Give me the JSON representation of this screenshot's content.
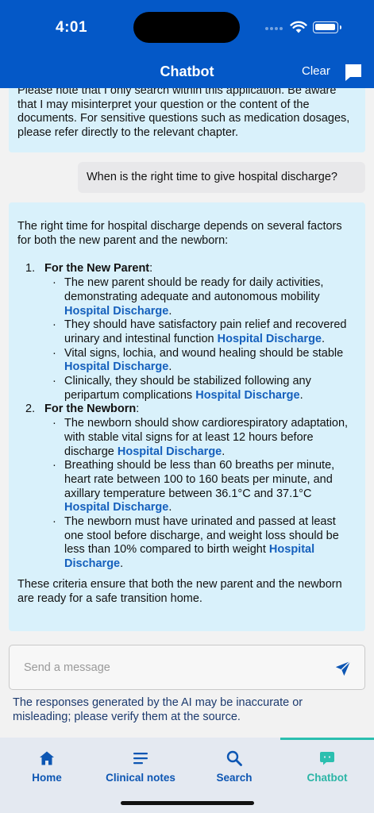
{
  "status": {
    "time": "4:01"
  },
  "header": {
    "title": "Chatbot",
    "clear_label": "Clear"
  },
  "messages": {
    "first_bot": {
      "line_cut": "Please note that I only search within this application. Be aware",
      "text": "that I may misinterpret your question or the content of the documents. For sensitive questions such as medication dosages, please refer directly to the relevant chapter."
    },
    "user": "When is the right time to give hospital discharge?",
    "bot": {
      "intro": "The right time for hospital discharge depends on several factors for both the new parent and the newborn:",
      "sections": [
        {
          "num": "1.",
          "title": "For the New Parent",
          "items": [
            {
              "text": "The new parent should be ready for daily activities, demonstrating adequate and autonomous mobility ",
              "ref": "Hospital Discharge",
              "end": "."
            },
            {
              "text": "They should have satisfactory pain relief and recovered urinary and intestinal function ",
              "ref": "Hospital Discharge",
              "end": "."
            },
            {
              "text": "Vital signs, lochia, and wound healing should be stable ",
              "ref": "Hospital Discharge",
              "end": "."
            },
            {
              "text": "Clinically, they should be stabilized following any peripartum complications ",
              "ref": "Hospital Discharge",
              "end": "."
            }
          ]
        },
        {
          "num": "2.",
          "title": "For the Newborn",
          "items": [
            {
              "text": "The newborn should show cardiorespiratory adaptation, with stable vital signs for at least 12 hours before discharge ",
              "ref": "Hospital Discharge",
              "end": "."
            },
            {
              "text": "Breathing should be less than 60 breaths per minute, heart rate between 100 to 160 beats per minute, and axillary temperature between 36.1°C and 37.1°C ",
              "ref": "Hospital Discharge",
              "end": "."
            },
            {
              "text": "The newborn must have urinated and passed at least one stool before discharge, and weight loss should be less than 10% compared to birth weight ",
              "ref": "Hospital Discharge",
              "end": "."
            }
          ]
        }
      ],
      "outro": "These criteria ensure that both the new parent and the newborn are ready for a safe transition home."
    }
  },
  "input": {
    "placeholder": "Send a message",
    "value": ""
  },
  "disclaimer": "The responses generated by the AI may be inaccurate or misleading; please verify them at the source.",
  "nav": {
    "items": [
      {
        "label": "Home",
        "icon": "home-icon"
      },
      {
        "label": "Clinical notes",
        "icon": "notes-icon"
      },
      {
        "label": "Search",
        "icon": "search-icon"
      },
      {
        "label": "Chatbot",
        "icon": "chatbot-icon"
      }
    ],
    "active_index": 3
  },
  "colors": {
    "header_bg": "#0458c7",
    "bot_bubble_bg": "#d9f1fb",
    "user_bubble_bg": "#e8e8ea",
    "link": "#1560bd",
    "nav_bg": "#e4e9f1",
    "nav_active": "#2bb5a6"
  }
}
